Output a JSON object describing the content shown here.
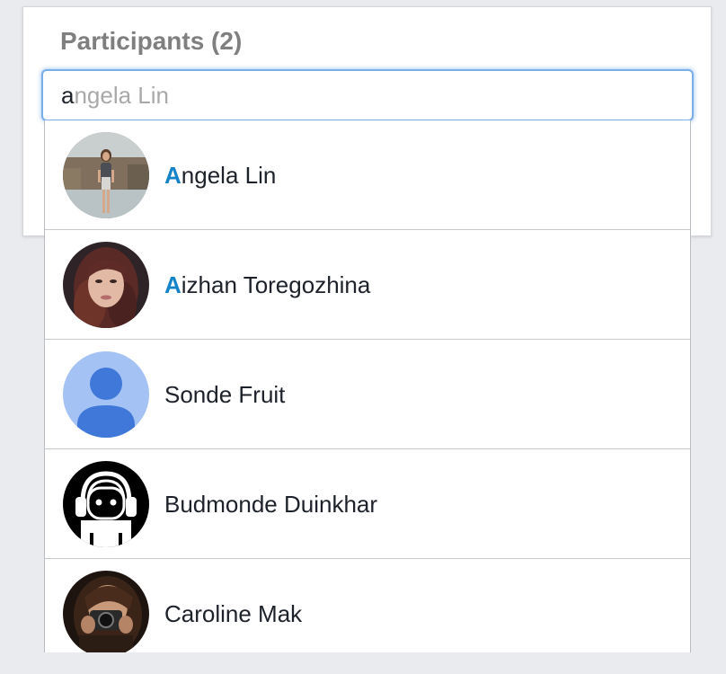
{
  "header": {
    "title": "Participants (2)"
  },
  "search": {
    "typed": "a",
    "suggestion": "ngela Lin"
  },
  "colors": {
    "match_highlight": "#1583c9",
    "input_focus_border": "#79aee9",
    "title_gray": "#7f7f7f",
    "background": "#e9ebee"
  },
  "results": [
    {
      "match": "A",
      "rest": "ngela Lin",
      "avatar": "photo-woman-standing"
    },
    {
      "match": "A",
      "rest": "izhan Toregozhina",
      "avatar": "photo-woman-portrait"
    },
    {
      "match": "",
      "rest": "Sonde Fruit",
      "avatar": "default-user-icon"
    },
    {
      "match": "",
      "rest": "Budmonde Duinkhar",
      "avatar": "headphones-robot-icon"
    },
    {
      "match": "",
      "rest": "Caroline Mak",
      "avatar": "photo-camera-selfie"
    }
  ]
}
